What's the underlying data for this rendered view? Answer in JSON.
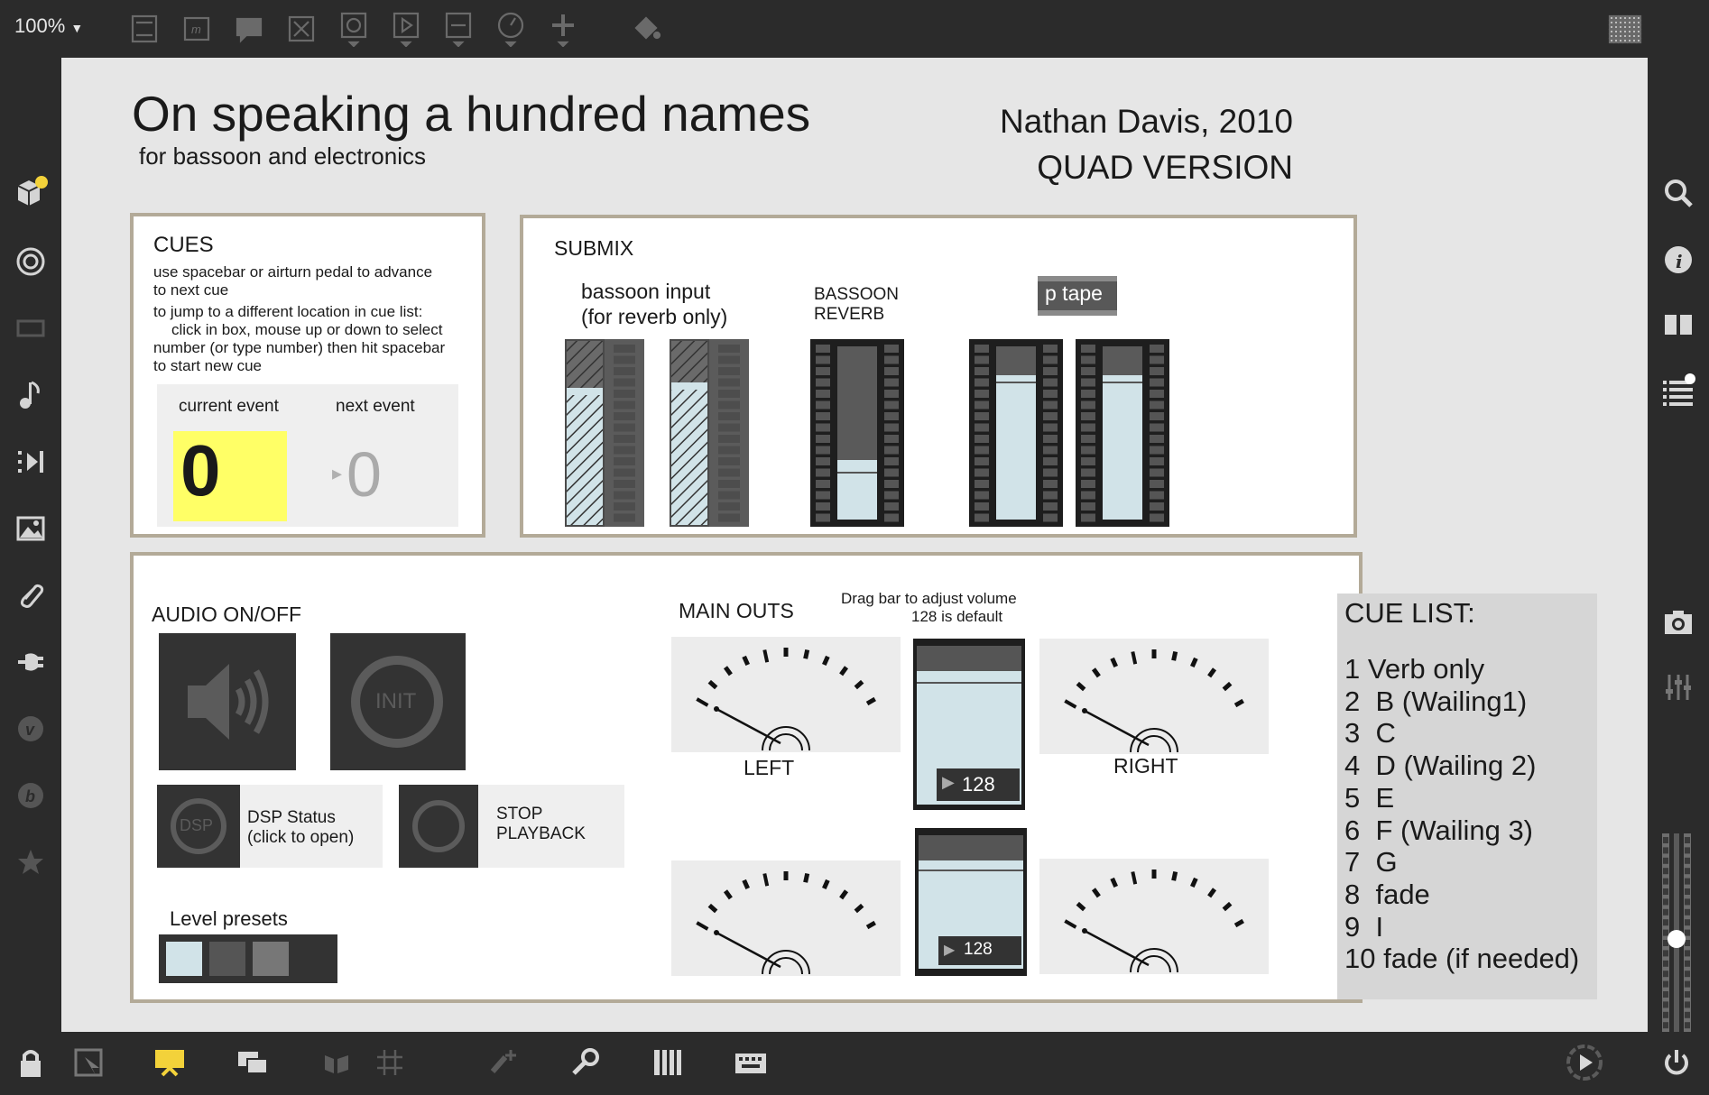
{
  "toolbar": {
    "zoom": "100%",
    "icons": [
      "presentation-icon",
      "message-icon",
      "comment-icon",
      "toggle-icon",
      "button-icon",
      "play-icon",
      "slider-icon",
      "dial-icon",
      "plus-icon",
      "paint-bucket-icon",
      "grid-icon"
    ]
  },
  "left_sidebar": {
    "icons": [
      "package-icon",
      "target-icon",
      "film-icon",
      "music-note-icon",
      "media-icon",
      "image-icon",
      "paperclip-icon",
      "plug-icon",
      "v-icon",
      "b-icon",
      "star-icon"
    ]
  },
  "right_sidebar": {
    "icons": [
      "search-icon",
      "info-icon",
      "columns-icon",
      "list-icon",
      "camera-icon",
      "mixer-icon"
    ]
  },
  "patch": {
    "title": "On speaking a hundred names",
    "subtitle": "for bassoon and electronics",
    "author": "Nathan Davis, 2010",
    "version": "QUAD VERSION",
    "cues": {
      "heading": "CUES",
      "line1": "use spacebar or airturn pedal  to advance",
      "line2": "to next cue",
      "line3": "to jump to a different location in cue list:",
      "line4": "click in box, mouse up or down to select",
      "line5": "number (or type number)  then hit spacebar",
      "line6": "to start new cue",
      "current_label": "current event",
      "next_label": "next event",
      "current_value": "0",
      "next_value": "0"
    },
    "submix": {
      "heading": "SUBMIX",
      "bassoon_line1": "bassoon input",
      "bassoon_line2": "(for reverb only)",
      "reverb_line1": "BASSOON",
      "reverb_line2": "REVERB",
      "tape_label": "p tape"
    },
    "audio": {
      "heading": "AUDIO ON/OFF",
      "init_label": "INIT",
      "dsp_icon_label": "DSP",
      "dsp_line1": "DSP Status",
      "dsp_line2": "(click to open)",
      "stop_line1": "STOP",
      "stop_line2": "PLAYBACK",
      "presets_label": "Level presets"
    },
    "main_outs": {
      "heading": "MAIN OUTS",
      "hint_line1": "Drag bar to adjust volume",
      "hint_line2": "128 is default",
      "left_label": "LEFT",
      "right_label": "RIGHT",
      "volume_top": "128",
      "volume_bottom": "128"
    },
    "cue_list": {
      "heading": "CUE LIST:",
      "items": [
        "1 Verb only",
        "2  B (Wailing1)",
        "3  C",
        "4  D (Wailing 2)",
        "5  E",
        "6  F (Wailing 3)",
        "7  G",
        "8  fade",
        "9  I",
        "10 fade (if needed)"
      ]
    }
  },
  "colors": {
    "frame": "#2b2b2b",
    "canvas": "#e6e6e6",
    "panel_border": "#b3aa98",
    "number_box_yellow": "#ffff66",
    "meter_fill": "#d1e3e8"
  },
  "bottom_toolbar": {
    "icons": [
      "lock-icon",
      "edit-mode-icon",
      "presentation-mode-icon",
      "windows-icon",
      "hide-icon",
      "grid-icon",
      "add-icon",
      "wrench-icon",
      "piano-icon",
      "keyboard-icon",
      "play-circle-icon",
      "power-icon"
    ]
  }
}
